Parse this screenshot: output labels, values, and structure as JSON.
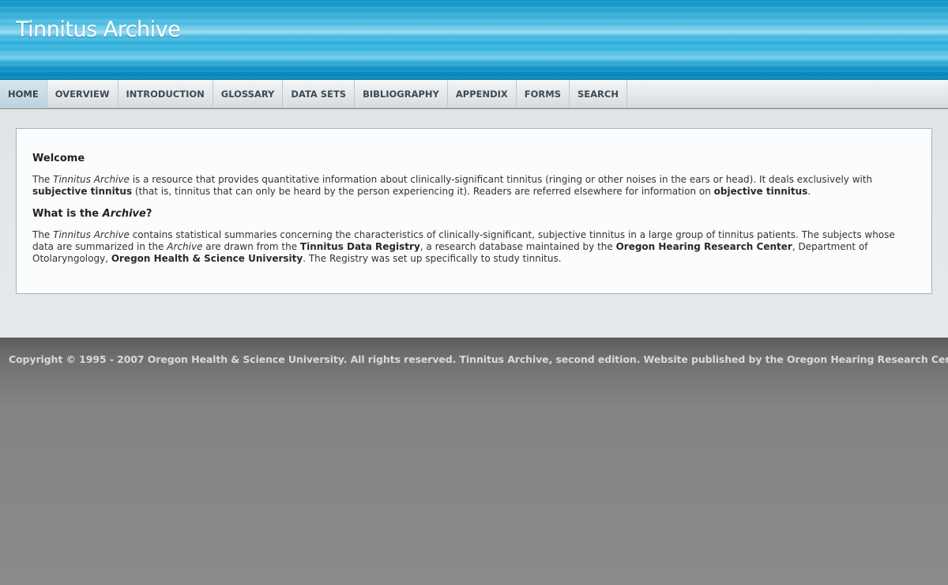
{
  "header": {
    "title": "Tinnitus Archive"
  },
  "nav": {
    "items": [
      {
        "label": "HOME",
        "active": true
      },
      {
        "label": "OVERVIEW"
      },
      {
        "label": "INTRODUCTION"
      },
      {
        "label": "GLOSSARY"
      },
      {
        "label": "DATA SETS"
      },
      {
        "label": "BIBLIOGRAPHY"
      },
      {
        "label": "APPENDIX"
      },
      {
        "label": "FORMS"
      },
      {
        "label": "SEARCH"
      }
    ]
  },
  "content": {
    "welcome_heading": "Welcome",
    "p1": {
      "t1": "The ",
      "i1": "Tinnitus Archive",
      "t2": " is a resource that provides quantitative information about clinically-significant tinnitus (ringing or other noises in the ears or head). It deals exclusively with ",
      "b1": "subjective tinnitus",
      "t3": " (that is, tinnitus that can only be heard by the person experiencing it). Readers are referred elsewhere for information on ",
      "b2": "objective tinnitus",
      "t4": "."
    },
    "what_heading": {
      "t1": "What is the ",
      "i1": "Archive",
      "t2": "?"
    },
    "p2": {
      "t1": "The ",
      "i1": "Tinnitus Archive",
      "t2": " contains statistical summaries concerning the characteristics of clinically-significant, subjective tinnitus in a large group of tinnitus patients. The subjects whose data are summarized in the ",
      "i2": "Archive",
      "t3": " are drawn from the ",
      "b1": "Tinnitus Data Registry",
      "t4": ", a research database maintained by the ",
      "b2": "Oregon Hearing Research Center",
      "t5": ", Department of Otolaryngology, ",
      "b3": "Oregon Health & Science University",
      "t6": ". The Registry was set up specifically to study tinnitus."
    }
  },
  "footer": {
    "copyright": "Copyright © 1995 - 2007 Oregon Health & Science University. All rights reserved. Tinnitus Archive, second edition. Website published by the Oregon Hearing Research Center."
  }
}
